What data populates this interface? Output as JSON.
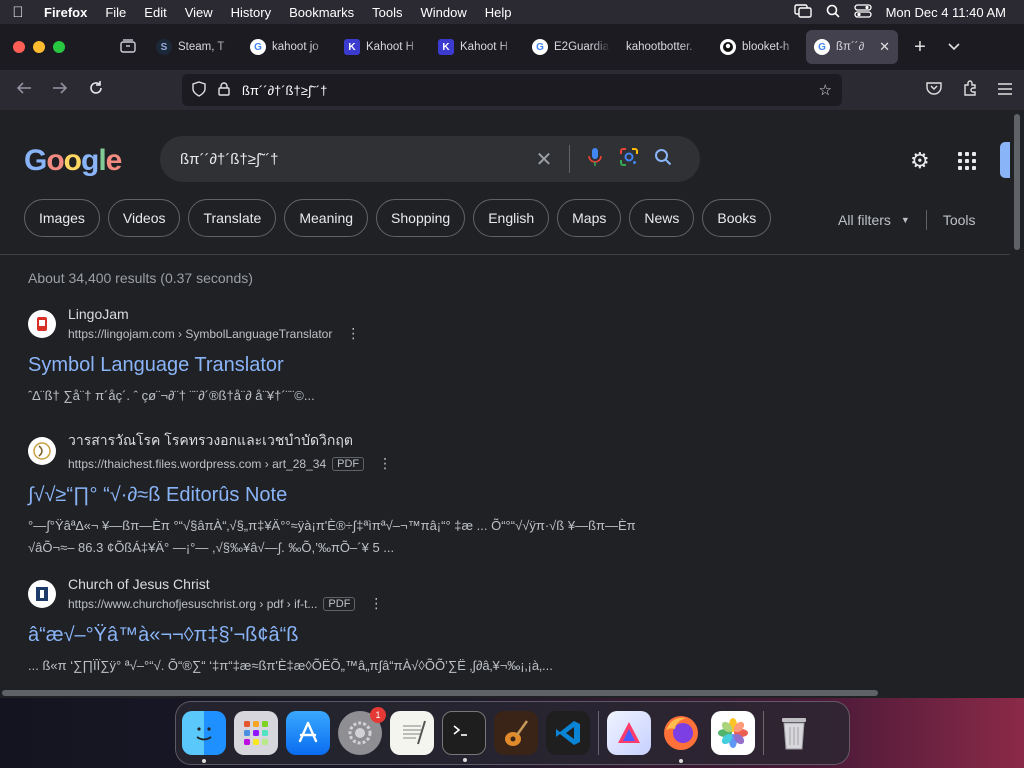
{
  "menubar": {
    "app": "Firefox",
    "items": [
      "File",
      "Edit",
      "View",
      "History",
      "Bookmarks",
      "Tools",
      "Window",
      "Help"
    ],
    "datetime": "Mon Dec 4  11:40 AM"
  },
  "tabs": [
    {
      "label": "Steam, T",
      "favicon": "steam-icon"
    },
    {
      "label": "kahoot jo",
      "favicon": "google-icon"
    },
    {
      "label": "Kahoot H",
      "favicon": "kahoot-icon"
    },
    {
      "label": "Kahoot H",
      "favicon": "kahoot-icon"
    },
    {
      "label": "E2Guardia",
      "favicon": "google-icon"
    },
    {
      "label": "kahootbotter.",
      "favicon": "none"
    },
    {
      "label": "blooket-h",
      "favicon": "github-icon"
    },
    {
      "label": "ßπ´´∂",
      "favicon": "google-icon",
      "active": true
    }
  ],
  "url": "ßπ´´∂†´ß†≥∫˜´†",
  "google": {
    "query": "ßπ´´∂†´ß†≥∫˜´†",
    "chips": [
      "Images",
      "Videos",
      "Translate",
      "Meaning",
      "Shopping",
      "English",
      "Maps",
      "News",
      "Books"
    ],
    "all_filters": "All filters",
    "tools": "Tools",
    "stats": "About 34,400 results (0.37 seconds)",
    "results": [
      {
        "site": "LingoJam",
        "url": "https://lingojam.com › SymbolLanguageTranslator",
        "pdf": "",
        "title": "Symbol Language Translator",
        "snippet": "ˆ∆¨ß† ∑å¨† π´åç´. ˆ çø¨¬∂¨† ¨¨∂´®ß†å¨∂ å¨¥†´¨¨©..."
      },
      {
        "site": "วารสารวัณโรค โรคทรวงอกและเวชบำบัดวิกฤต",
        "url": "https://thaichest.files.wordpress.com › art_28_34",
        "pdf": "PDF",
        "title": "∫√√≥“∏°  “√·∂≈ß Editorûs Note",
        "snippet": "°—∫°Ÿâª∆«¬ ¥—ßπ—Èπ °“√§âπÀ“‚√§„π‡¥Ä°°≈ÿà¡π'È®÷∫‡ªìπª√–¬™πâ¡“° ‡æ ... Õ“°“√√ÿπ·√ß ¥—ßπ—Èπ √âÕ¬≈– 86.3 ¢ÕßÁ‡¥Ä° —¡°— ,√§‰¥â√—∫. ‰Õ,’‰πÕ–´¥ 5 ..."
      },
      {
        "site": "Church of Jesus Christ",
        "url": "https://www.churchofjesuschrist.org › pdf › if-t...",
        "pdf": "PDF",
        "title": "â“æ√–°Ÿâ™à«¬¬◊π‡§'¬ß¢â“ß",
        "snippet": "... ß«π ‘∑∏ÏÏ∑ÿ° ª√–°“√. Õ“®∑“ ‘‡π“‡æ≈ßπ'È‡æ◊ÕËÕ„™â„π∫â“πÀ√◊ÕÕ’∑Ë ‚∫∂â‚¥¬‰¡‚¡à‚..."
      }
    ]
  },
  "dock": {
    "apps": [
      "finder-icon",
      "launchpad-icon",
      "app-store-icon",
      "system-settings-icon",
      "textedit-icon",
      "terminal-icon",
      "garageband-icon",
      "vscode-icon",
      "affinity-icon",
      "firefox-icon",
      "photos-icon",
      "trash-icon"
    ],
    "settings_badge": "1"
  },
  "colors": {
    "link": "#8ab4f8",
    "page_bg": "#202124",
    "chrome_bg": "#2b2a33"
  }
}
